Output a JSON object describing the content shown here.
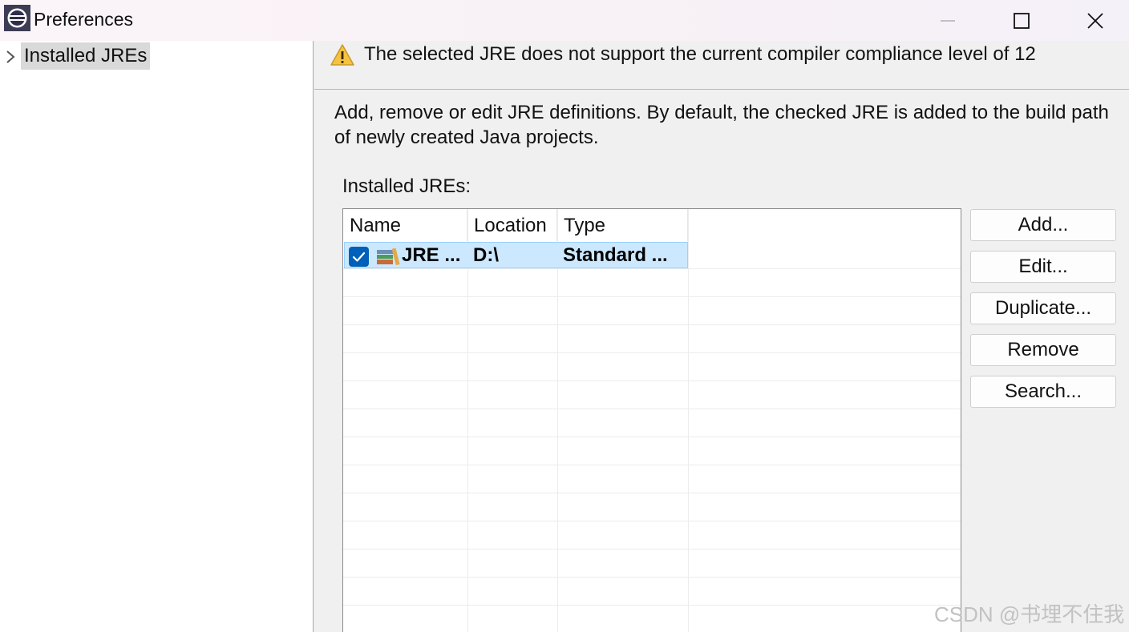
{
  "window": {
    "title": "Preferences"
  },
  "tree": {
    "items": [
      {
        "label": "Installed JREs"
      }
    ]
  },
  "warning": {
    "text": "The selected JRE does not support the current compiler compliance level of 12"
  },
  "description": "Add, remove or edit JRE definitions. By default, the checked JRE is added to the build path of newly created Java projects.",
  "installed_label": "Installed JREs:",
  "table": {
    "columns": [
      "Name",
      "Location",
      "Type"
    ],
    "rows": [
      {
        "name": "JRE ...",
        "location": "D:\\",
        "type": "Standard ...",
        "checked": true
      }
    ]
  },
  "buttons": {
    "add": "Add...",
    "edit": "Edit...",
    "duplicate": "Duplicate...",
    "remove": "Remove",
    "search": "Search..."
  },
  "watermark": "CSDN @书埋不住我",
  "colors": {
    "selection": "#cce8ff",
    "checkbox": "#005fb8",
    "warning": "#f5c242"
  }
}
